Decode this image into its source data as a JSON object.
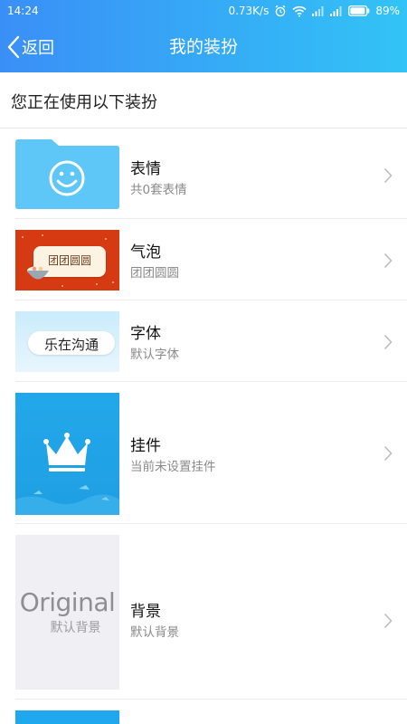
{
  "status_bar": {
    "time": "14:24",
    "network_speed": "0.73K/s",
    "battery": "89%",
    "icons": [
      "alarm-icon",
      "wifi-icon",
      "signal-icon",
      "signal-icon",
      "battery-icon"
    ]
  },
  "title_bar": {
    "back_label": "返回",
    "title": "我的装扮"
  },
  "section": {
    "title": "您正在使用以下装扮"
  },
  "items": [
    {
      "title": "表情",
      "subtitle": "共0套表情"
    },
    {
      "title": "气泡",
      "subtitle": "团团圆圆",
      "thumb_text": "团团圆圆"
    },
    {
      "title": "字体",
      "subtitle": "默认字体",
      "thumb_text": "乐在沟通"
    },
    {
      "title": "挂件",
      "subtitle": "当前未设置挂件"
    },
    {
      "title": "背景",
      "subtitle": "默认背景",
      "thumb_text": "Original",
      "thumb_subtext": "默认背景"
    }
  ],
  "colors": {
    "header_start": "#3a8ff7",
    "header_end": "#33c3f6",
    "folder_blue": "#5ec7f7",
    "bubble_red": "#d63a12",
    "pendant_blue": "#22a8ea"
  }
}
